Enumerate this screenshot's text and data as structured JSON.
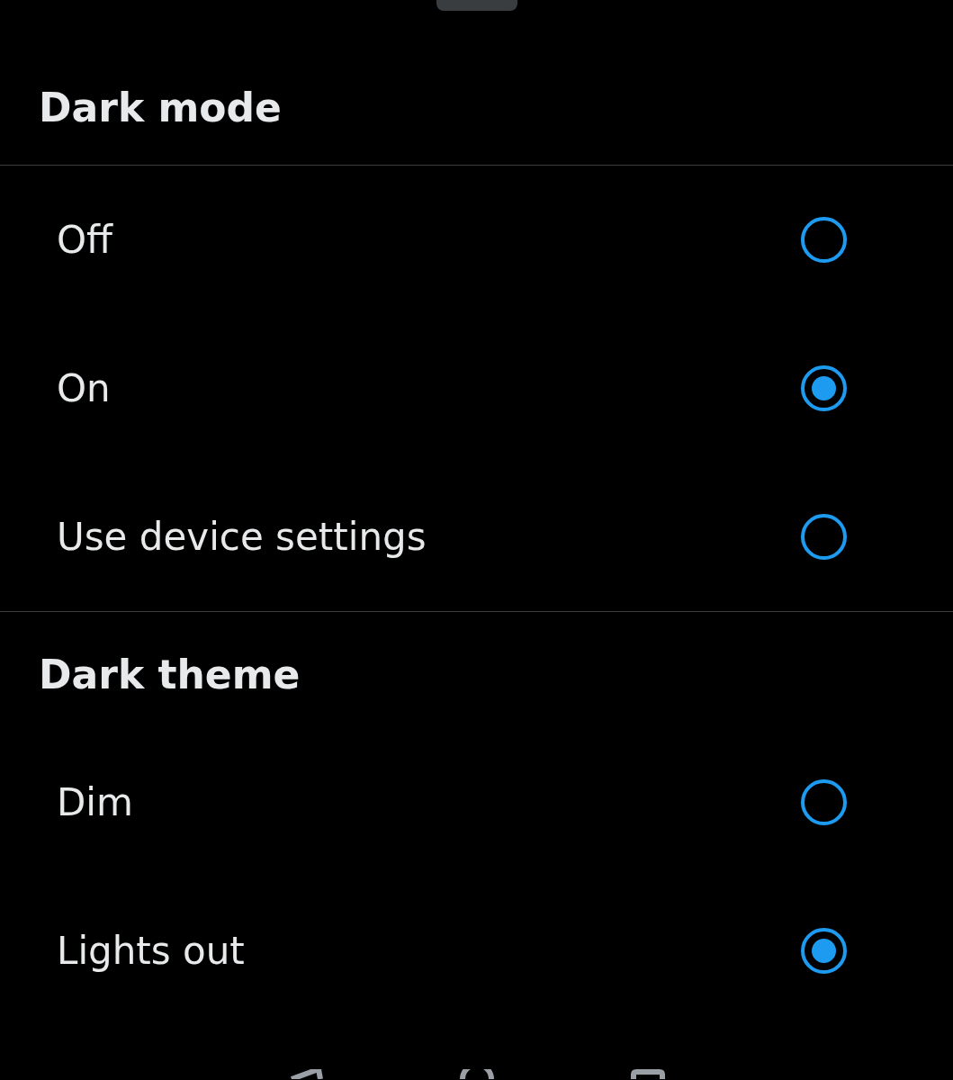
{
  "sections": [
    {
      "title": "Dark mode",
      "options": [
        {
          "label": "Off",
          "selected": false
        },
        {
          "label": "On",
          "selected": true
        },
        {
          "label": "Use device settings",
          "selected": false
        }
      ]
    },
    {
      "title": "Dark theme",
      "options": [
        {
          "label": "Dim",
          "selected": false
        },
        {
          "label": "Lights out",
          "selected": true
        }
      ]
    }
  ]
}
